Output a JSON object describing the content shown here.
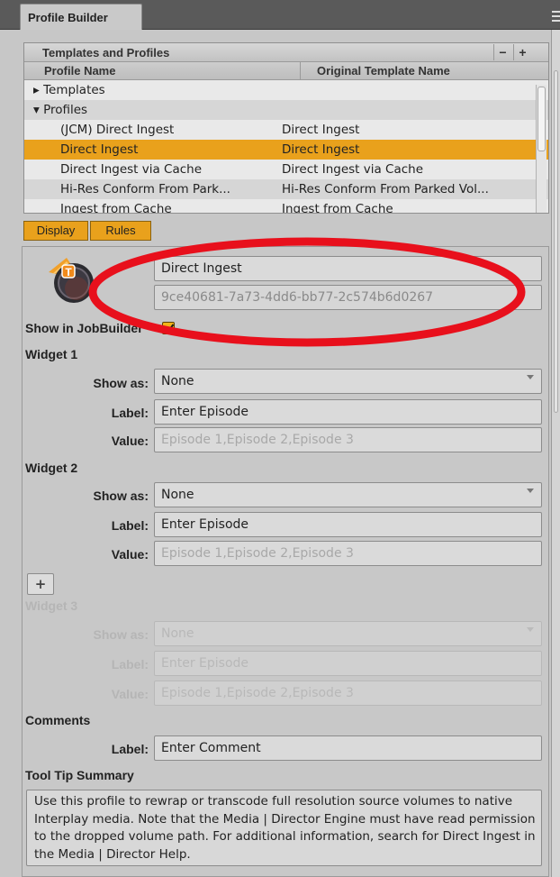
{
  "tab": {
    "title": "Profile Builder"
  },
  "templates_panel": {
    "title": "Templates and Profiles",
    "minus_label": "−",
    "plus_label": "+",
    "columns": [
      "Profile Name",
      "Original Template Name"
    ],
    "rows": [
      {
        "name": "▸ Templates",
        "template": "",
        "indent": 0,
        "selected": false
      },
      {
        "name": "▾ Profiles",
        "template": "",
        "indent": 0,
        "selected": false
      },
      {
        "name": "(JCM) Direct Ingest",
        "template": "Direct Ingest",
        "indent": 1,
        "selected": false
      },
      {
        "name": "Direct Ingest",
        "template": "Direct Ingest",
        "indent": 1,
        "selected": true
      },
      {
        "name": "Direct Ingest via Cache",
        "template": "Direct Ingest via Cache",
        "indent": 1,
        "selected": false
      },
      {
        "name": "Hi-Res Conform From Park...",
        "template": "Hi-Res Conform From Parked Vol...",
        "indent": 1,
        "selected": false
      },
      {
        "name": "Ingest from Cache",
        "template": "Ingest from Cache",
        "indent": 1,
        "selected": false
      }
    ]
  },
  "mode_tabs": {
    "display": "Display",
    "rules": "Rules"
  },
  "profile": {
    "name": "Direct Ingest",
    "id": "9ce40681-7a73-4dd6-bb77-2c574b6d0267",
    "show_in_jobbuilder_label": "Show in JobBuilder",
    "show_in_jobbuilder": true
  },
  "labels": {
    "show_as": "Show as:",
    "label": "Label:",
    "value": "Value:"
  },
  "widgets": [
    {
      "title": "Widget 1",
      "show_as": "None",
      "label": "Enter Episode",
      "value_placeholder": "Episode 1,Episode 2,Episode 3",
      "enabled": true
    },
    {
      "title": "Widget 2",
      "show_as": "None",
      "label": "Enter Episode",
      "value_placeholder": "Episode 1,Episode 2,Episode 3",
      "enabled": true
    },
    {
      "title": "Widget 3",
      "show_as": "None",
      "label": "Enter Episode",
      "value_placeholder": "Episode 1,Episode 2,Episode 3",
      "enabled": false
    }
  ],
  "add_widget_label": "+",
  "comments": {
    "title": "Comments",
    "label_caption": "Label:",
    "label": "Enter Comment"
  },
  "tooltip": {
    "title": "Tool Tip Summary",
    "text": "Use this profile to rewrap or transcode full resolution source volumes to native Interplay media. Note that the Media | Director Engine must have read permission to the dropped volume path. For additional information, search for Direct Ingest in the Media | Director Help."
  },
  "colors": {
    "selection": "#e9a11c",
    "annotation": "#e8101c",
    "panel": "#c8c8c8"
  },
  "icons": {
    "profile_logo": "transcode-profile-icon",
    "check": "checkmark-icon"
  }
}
